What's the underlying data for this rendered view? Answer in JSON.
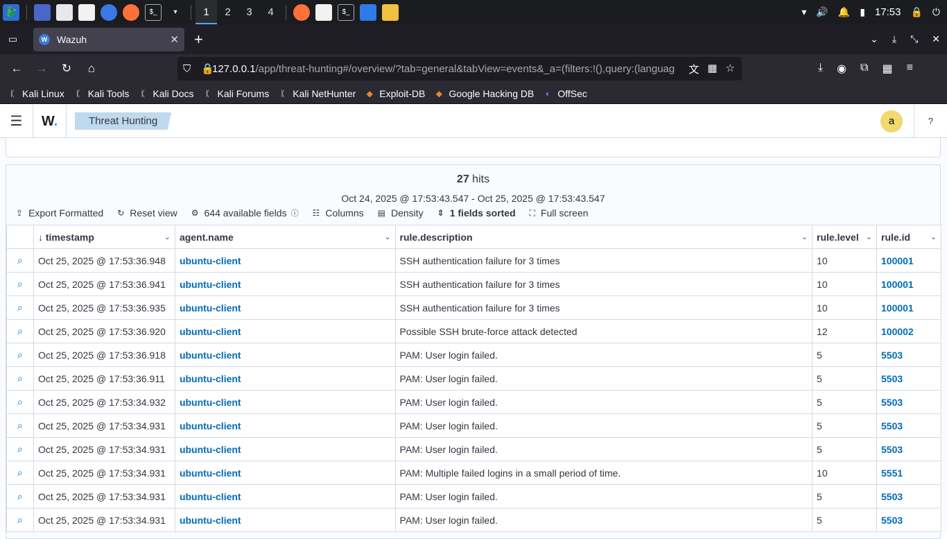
{
  "taskbar": {
    "workspaces": [
      "1",
      "2",
      "3",
      "4"
    ],
    "active_workspace": "1",
    "clock": "17:53",
    "icons": [
      "kali-menu-icon",
      "desktop-icon",
      "file-manager-icon",
      "text-editor-icon",
      "chromium-icon",
      "firefox-icon",
      "terminal-icon"
    ]
  },
  "browser": {
    "tab_title": "Wazuh",
    "tab_favicon_letter": "W",
    "url_host": "127.0.0.1",
    "url_rest": "/app/threat-hunting#/overview/?tab=general&tabView=events&_a=(filters:!(),query:(language",
    "bookmarks": [
      "Kali Linux",
      "Kali Tools",
      "Kali Docs",
      "Kali Forums",
      "Kali NetHunter",
      "Exploit-DB",
      "Google Hacking DB",
      "OffSec"
    ]
  },
  "app": {
    "logo": "W",
    "breadcrumb": "Threat Hunting",
    "avatar_letter": "a"
  },
  "grid": {
    "hits_count": "27",
    "hits_label": "hits",
    "time_range": "Oct 24, 2025 @ 17:53:43.547 - Oct 25, 2025 @ 17:53:43.547",
    "toolbar": {
      "export": "Export Formatted",
      "reset": "Reset view",
      "fields": "644 available fields",
      "columns": "Columns",
      "density": "Density",
      "sorted": "1 fields sorted",
      "fullscreen": "Full screen"
    },
    "columns": [
      "timestamp",
      "agent.name",
      "rule.description",
      "rule.level",
      "rule.id"
    ],
    "rows": [
      {
        "timestamp": "Oct 25, 2025 @ 17:53:36.948",
        "agent": "ubuntu-client",
        "description": "SSH authentication failure for 3 times",
        "level": "10",
        "id": "100001"
      },
      {
        "timestamp": "Oct 25, 2025 @ 17:53:36.941",
        "agent": "ubuntu-client",
        "description": "SSH authentication failure for 3 times",
        "level": "10",
        "id": "100001"
      },
      {
        "timestamp": "Oct 25, 2025 @ 17:53:36.935",
        "agent": "ubuntu-client",
        "description": "SSH authentication failure for 3 times",
        "level": "10",
        "id": "100001"
      },
      {
        "timestamp": "Oct 25, 2025 @ 17:53:36.920",
        "agent": "ubuntu-client",
        "description": "Possible SSH brute-force attack detected",
        "level": "12",
        "id": "100002"
      },
      {
        "timestamp": "Oct 25, 2025 @ 17:53:36.918",
        "agent": "ubuntu-client",
        "description": "PAM: User login failed.",
        "level": "5",
        "id": "5503"
      },
      {
        "timestamp": "Oct 25, 2025 @ 17:53:36.911",
        "agent": "ubuntu-client",
        "description": "PAM: User login failed.",
        "level": "5",
        "id": "5503"
      },
      {
        "timestamp": "Oct 25, 2025 @ 17:53:34.932",
        "agent": "ubuntu-client",
        "description": "PAM: User login failed.",
        "level": "5",
        "id": "5503"
      },
      {
        "timestamp": "Oct 25, 2025 @ 17:53:34.931",
        "agent": "ubuntu-client",
        "description": "PAM: User login failed.",
        "level": "5",
        "id": "5503"
      },
      {
        "timestamp": "Oct 25, 2025 @ 17:53:34.931",
        "agent": "ubuntu-client",
        "description": "PAM: User login failed.",
        "level": "5",
        "id": "5503"
      },
      {
        "timestamp": "Oct 25, 2025 @ 17:53:34.931",
        "agent": "ubuntu-client",
        "description": "PAM: Multiple failed logins in a small period of time.",
        "level": "10",
        "id": "5551"
      },
      {
        "timestamp": "Oct 25, 2025 @ 17:53:34.931",
        "agent": "ubuntu-client",
        "description": "PAM: User login failed.",
        "level": "5",
        "id": "5503"
      },
      {
        "timestamp": "Oct 25, 2025 @ 17:53:34.931",
        "agent": "ubuntu-client",
        "description": "PAM: User login failed.",
        "level": "5",
        "id": "5503"
      }
    ]
  },
  "colors": {
    "accent_link": "#006bb8",
    "breadcrumb_bg": "#bfd9ef",
    "avatar_bg": "#f1d86f"
  }
}
